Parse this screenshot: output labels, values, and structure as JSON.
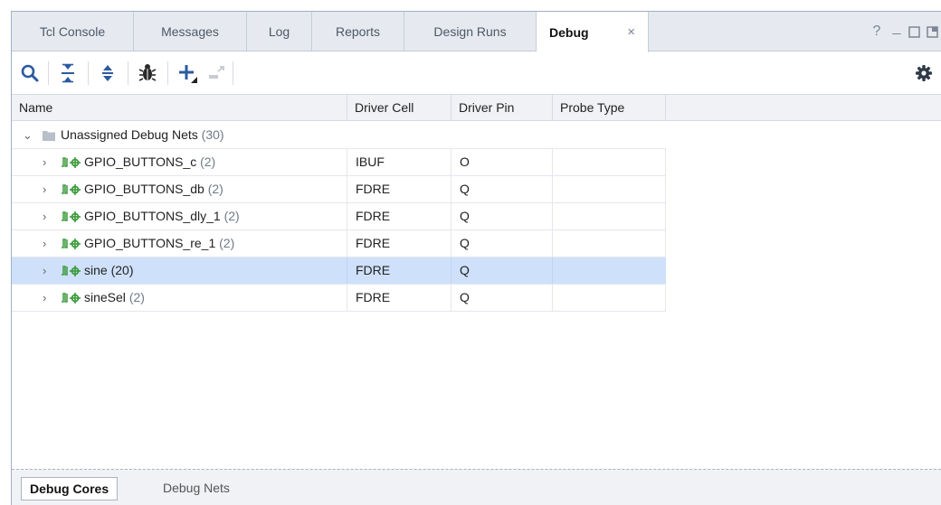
{
  "tabs": [
    {
      "label": "Tcl Console"
    },
    {
      "label": "Messages"
    },
    {
      "label": "Log"
    },
    {
      "label": "Reports"
    },
    {
      "label": "Design Runs"
    },
    {
      "label": "Debug",
      "active": true,
      "close": "×"
    }
  ],
  "window_controls": {
    "help": "?",
    "minimize": "_"
  },
  "toolbar": {
    "icons": [
      "search-icon",
      "collapse-all-icon",
      "expand-all-icon",
      "debug-bug-icon",
      "add-icon",
      "disabled-action-icon",
      "settings-gear-icon"
    ]
  },
  "columns": [
    {
      "label": "Name"
    },
    {
      "label": "Driver Cell"
    },
    {
      "label": "Driver Pin"
    },
    {
      "label": "Probe Type"
    }
  ],
  "group": {
    "label": "Unassigned Debug Nets",
    "count": "(30)"
  },
  "rows": [
    {
      "name": "GPIO_BUTTONS_c",
      "count": "(2)",
      "driver_cell": "IBUF",
      "driver_pin": "O",
      "probe_type": ""
    },
    {
      "name": "GPIO_BUTTONS_db",
      "count": "(2)",
      "driver_cell": "FDRE",
      "driver_pin": "Q",
      "probe_type": ""
    },
    {
      "name": "GPIO_BUTTONS_dly_1",
      "count": "(2)",
      "driver_cell": "FDRE",
      "driver_pin": "Q",
      "probe_type": ""
    },
    {
      "name": "GPIO_BUTTONS_re_1",
      "count": "(2)",
      "driver_cell": "FDRE",
      "driver_pin": "Q",
      "probe_type": ""
    },
    {
      "name": "sine",
      "count": "(20)",
      "driver_cell": "FDRE",
      "driver_pin": "Q",
      "probe_type": "",
      "selected": true
    },
    {
      "name": "sineSel",
      "count": "(2)",
      "driver_cell": "FDRE",
      "driver_pin": "Q",
      "probe_type": ""
    }
  ],
  "bottom_tabs": [
    {
      "label": "Debug Cores",
      "active": true
    },
    {
      "label": "Debug Nets"
    }
  ],
  "colors": {
    "selection": "#cfe0fa",
    "net_icon": "#3a9a3a",
    "accent": "#2c5aa0"
  }
}
